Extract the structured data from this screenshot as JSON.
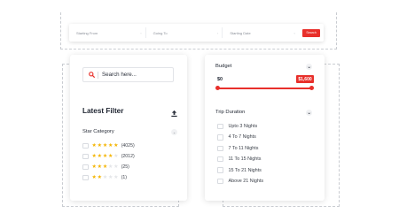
{
  "top_search": {
    "fields": [
      {
        "label": "Starting From",
        "icon": "location-icon"
      },
      {
        "label": "Going To",
        "icon": "location-icon"
      },
      {
        "label": "Starting Date",
        "icon": "calendar-icon"
      }
    ],
    "button_label": "Search"
  },
  "left_panel": {
    "search_placeholder": "Search here...",
    "filter_title": "Latest Filter",
    "star_category": "Star Category",
    "ratings": [
      {
        "stars": 5,
        "count": "(4025)"
      },
      {
        "stars": 4,
        "count": "(2012)"
      },
      {
        "stars": 3,
        "count": "(25)"
      },
      {
        "stars": 2,
        "count": "(1)"
      }
    ]
  },
  "right_panel": {
    "budget_title": "Budget",
    "min_value": "$0",
    "max_value": "$1,600",
    "trip_title": "Trip Duration",
    "durations": [
      "Upto 3 Nights",
      "4 To 7 Nights",
      "7 To 11 Nights",
      "11 To 15 Nights",
      "15 To 21 Nights",
      "Above 21 Nights"
    ]
  },
  "colors": {
    "accent": "#e8302b",
    "star": "#f4b400"
  }
}
